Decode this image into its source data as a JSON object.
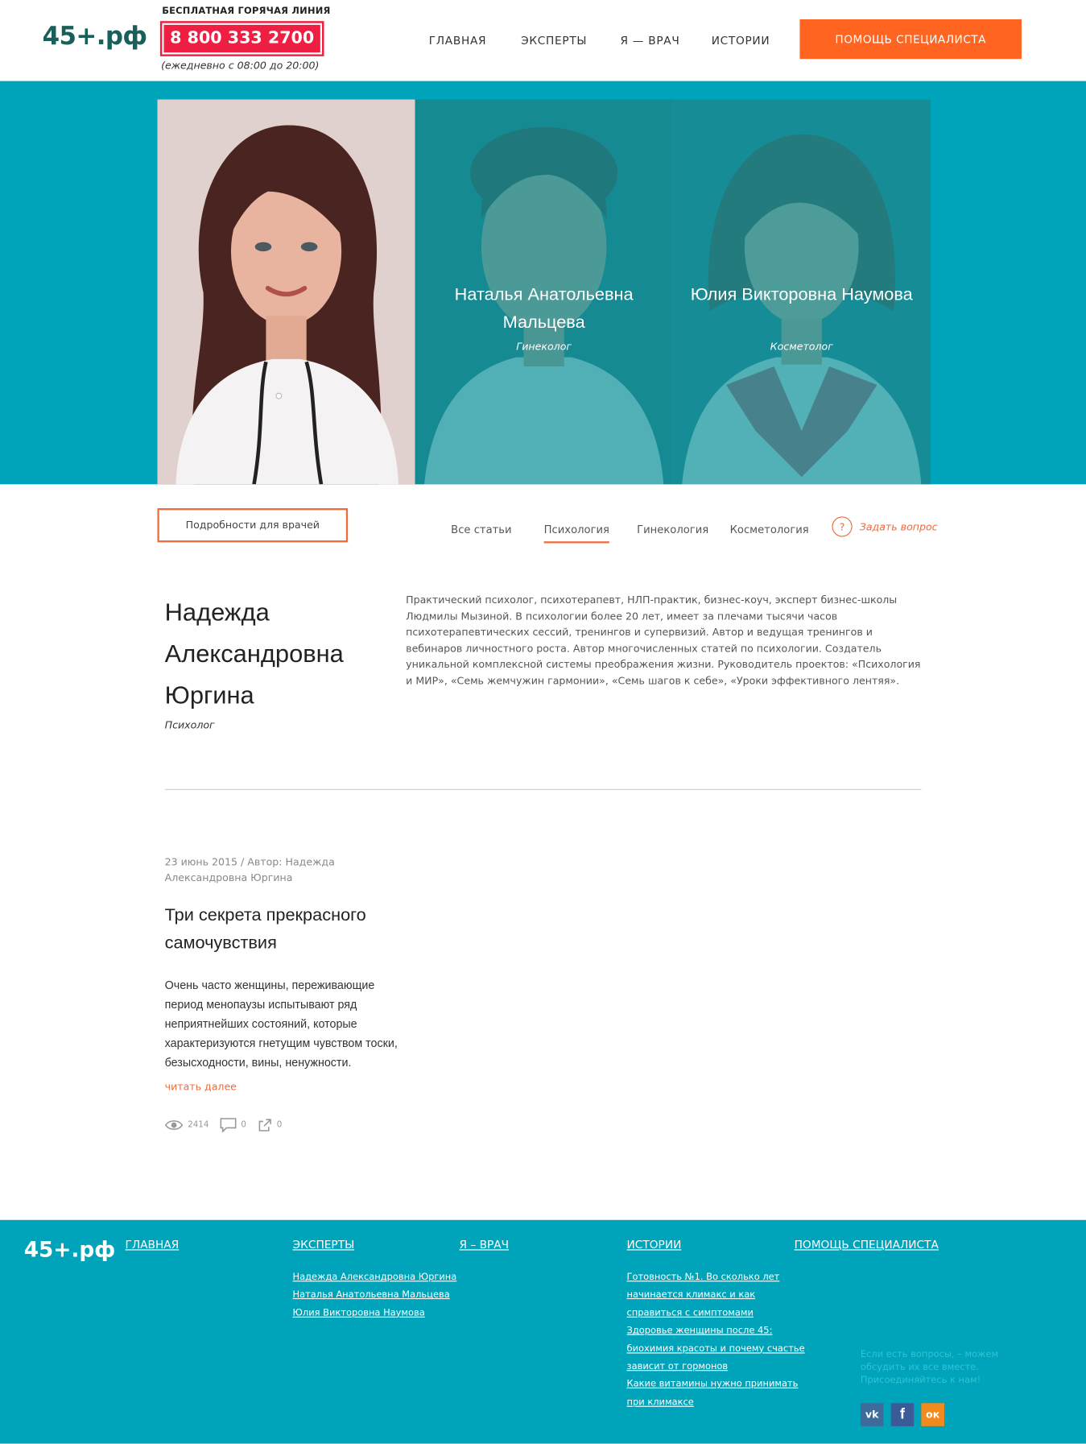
{
  "header": {
    "logo": "45+.рф",
    "hotline_title": "БЕСПЛАТНАЯ ГОРЯЧАЯ ЛИНИЯ",
    "phone": "8 800 333 2700",
    "hours": "(ежедневно с 08:00 до 20:00)",
    "nav": [
      "ГЛАВНАЯ",
      "ЭКСПЕРТЫ",
      "Я — ВРАЧ",
      "ИСТОРИИ"
    ],
    "cta": "ПОМОЩЬ СПЕЦИАЛИСТА"
  },
  "experts": [
    {
      "name": "",
      "spec": ""
    },
    {
      "name": "Наталья Анатольевна Мальцева",
      "spec": "Гинеколог"
    },
    {
      "name": "Юлия Викторовна Наумова",
      "spec": "Косметолог"
    }
  ],
  "tabs": {
    "doctors_button": "Подробности для врачей",
    "items": [
      "Все статьи",
      "Психология",
      "Гинекология",
      "Косметология"
    ],
    "active": "Психология",
    "ask_icon": "?",
    "ask": "Задать вопрос"
  },
  "profile": {
    "name": "Надежда Александровна Юргина",
    "role": "Психолог",
    "bio": "Практический психолог, психотерапевт, НЛП-практик, бизнес-коуч, эксперт бизнес-школы Людмилы Мызиной. В психологии более 20 лет, имеет за плечами тысячи часов психотерапевтических сессий, тренингов и супервизий. Автор и ведущая тренингов и вебинаров личностного роста. Автор многочисленных статей по психологии. Создатель уникальной комплексной системы преображения жизни. Руководитель проектов: «Психология и МИР», «Семь жемчужин гармонии», «Семь шагов к себе», «Уроки эффективного лентяя»."
  },
  "article": {
    "meta": "23 июнь 2015 / Автор: Надежда Александровна Юргина",
    "title": "Три секрета прекрасного самочувствия",
    "text": "Очень часто женщины, переживающие период менопаузы испытывают ряд неприятнейших состояний, которые характеризуются гнетущим чувством тоски, безысходности, вины, ненужности.",
    "read_more": "читать далее",
    "views": "2414",
    "comments": "0",
    "shares": "0"
  },
  "footer": {
    "logo": "45+.рф",
    "columns": {
      "home": "ГЛАВНАЯ",
      "experts": "ЭКСПЕРТЫ",
      "doctor": "Я – ВРАЧ",
      "stories": "ИСТОРИИ",
      "help": "ПОМОЩЬ СПЕЦИАЛИСТА"
    },
    "expert_links": [
      "Надежда Александровна Юргина",
      "Наталья Анатольевна Мальцева",
      "Юлия Викторовна Наумова"
    ],
    "story_links": [
      "Готовность №1. Во сколько лет",
      "начинается климакс и как",
      "справиться с симптомами",
      "Здоровье женщины после 45:",
      "биохимия красоты и почему счастье",
      "зависит от гормонов",
      "Какие витамины нужно принимать",
      "при климаксе"
    ],
    "note": "Если есть вопросы, – можем обсудить их все вместе. Присоединяйтесь к нам!",
    "social": [
      "vk-icon",
      "facebook-icon",
      "odnoklassniki-icon"
    ],
    "social_labels": {
      "vk": "vk",
      "fb": "f",
      "ok": "ок"
    }
  },
  "colors": {
    "teal": "#00a4ba",
    "orange": "#ff6421",
    "phone_red": "#ef1f43",
    "logo_green": "#1b5f5b"
  }
}
